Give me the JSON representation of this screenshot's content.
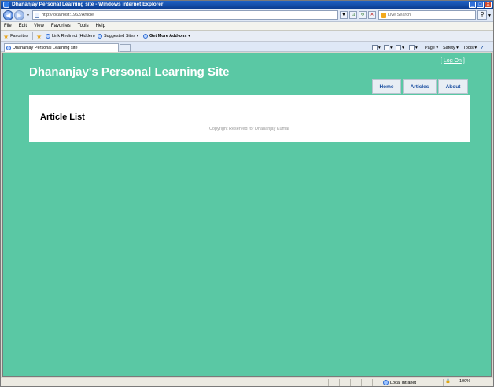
{
  "window": {
    "title": "Dhananjay Personal Learning site - Windows Internet Explorer",
    "minimize": "_",
    "maximize": "□",
    "close": "X"
  },
  "address_bar": {
    "back_glyph": "◀",
    "forward_glyph": "▶",
    "dropdown_glyph": "▼",
    "url": "http://localhost:1962/Article",
    "compat_glyph": "⊡",
    "refresh_glyph": "↻",
    "stop_glyph": "✕"
  },
  "search": {
    "placeholder": "Live Search",
    "button_glyph": "⚲",
    "dropdown_glyph": "▼"
  },
  "menu": {
    "items": [
      "File",
      "Edit",
      "View",
      "Favorites",
      "Tools",
      "Help"
    ]
  },
  "favorites_bar": {
    "favorites": "Favorites",
    "link_redirect": "Link Redirect (Hidden)",
    "suggested_sites": "Suggested Sites ▾",
    "get_addons": "Get More Add-ons ▾"
  },
  "tabs": {
    "active": "Dhananjay Personal Learning site"
  },
  "command_bar": {
    "page": "Page ▾",
    "safety": "Safety ▾",
    "tools": "Tools ▾",
    "help": "?"
  },
  "page": {
    "logon_open": "[",
    "logon_label": "Log On",
    "logon_close": "]",
    "site_title": "Dhananjay's Personal Learning Site",
    "nav": {
      "home": "Home",
      "articles": "Articles",
      "about": "About"
    },
    "heading": "Article List",
    "footer": "Copyright Reserved for Dhananjay Kumar"
  },
  "status_bar": {
    "zone": "Local intranet",
    "protected_glyph": "🔒",
    "zoom": "100%"
  },
  "colors": {
    "page_background": "#5ac8a4",
    "nav_text": "#1a4ea0",
    "title_bar": "#1f62c6"
  }
}
